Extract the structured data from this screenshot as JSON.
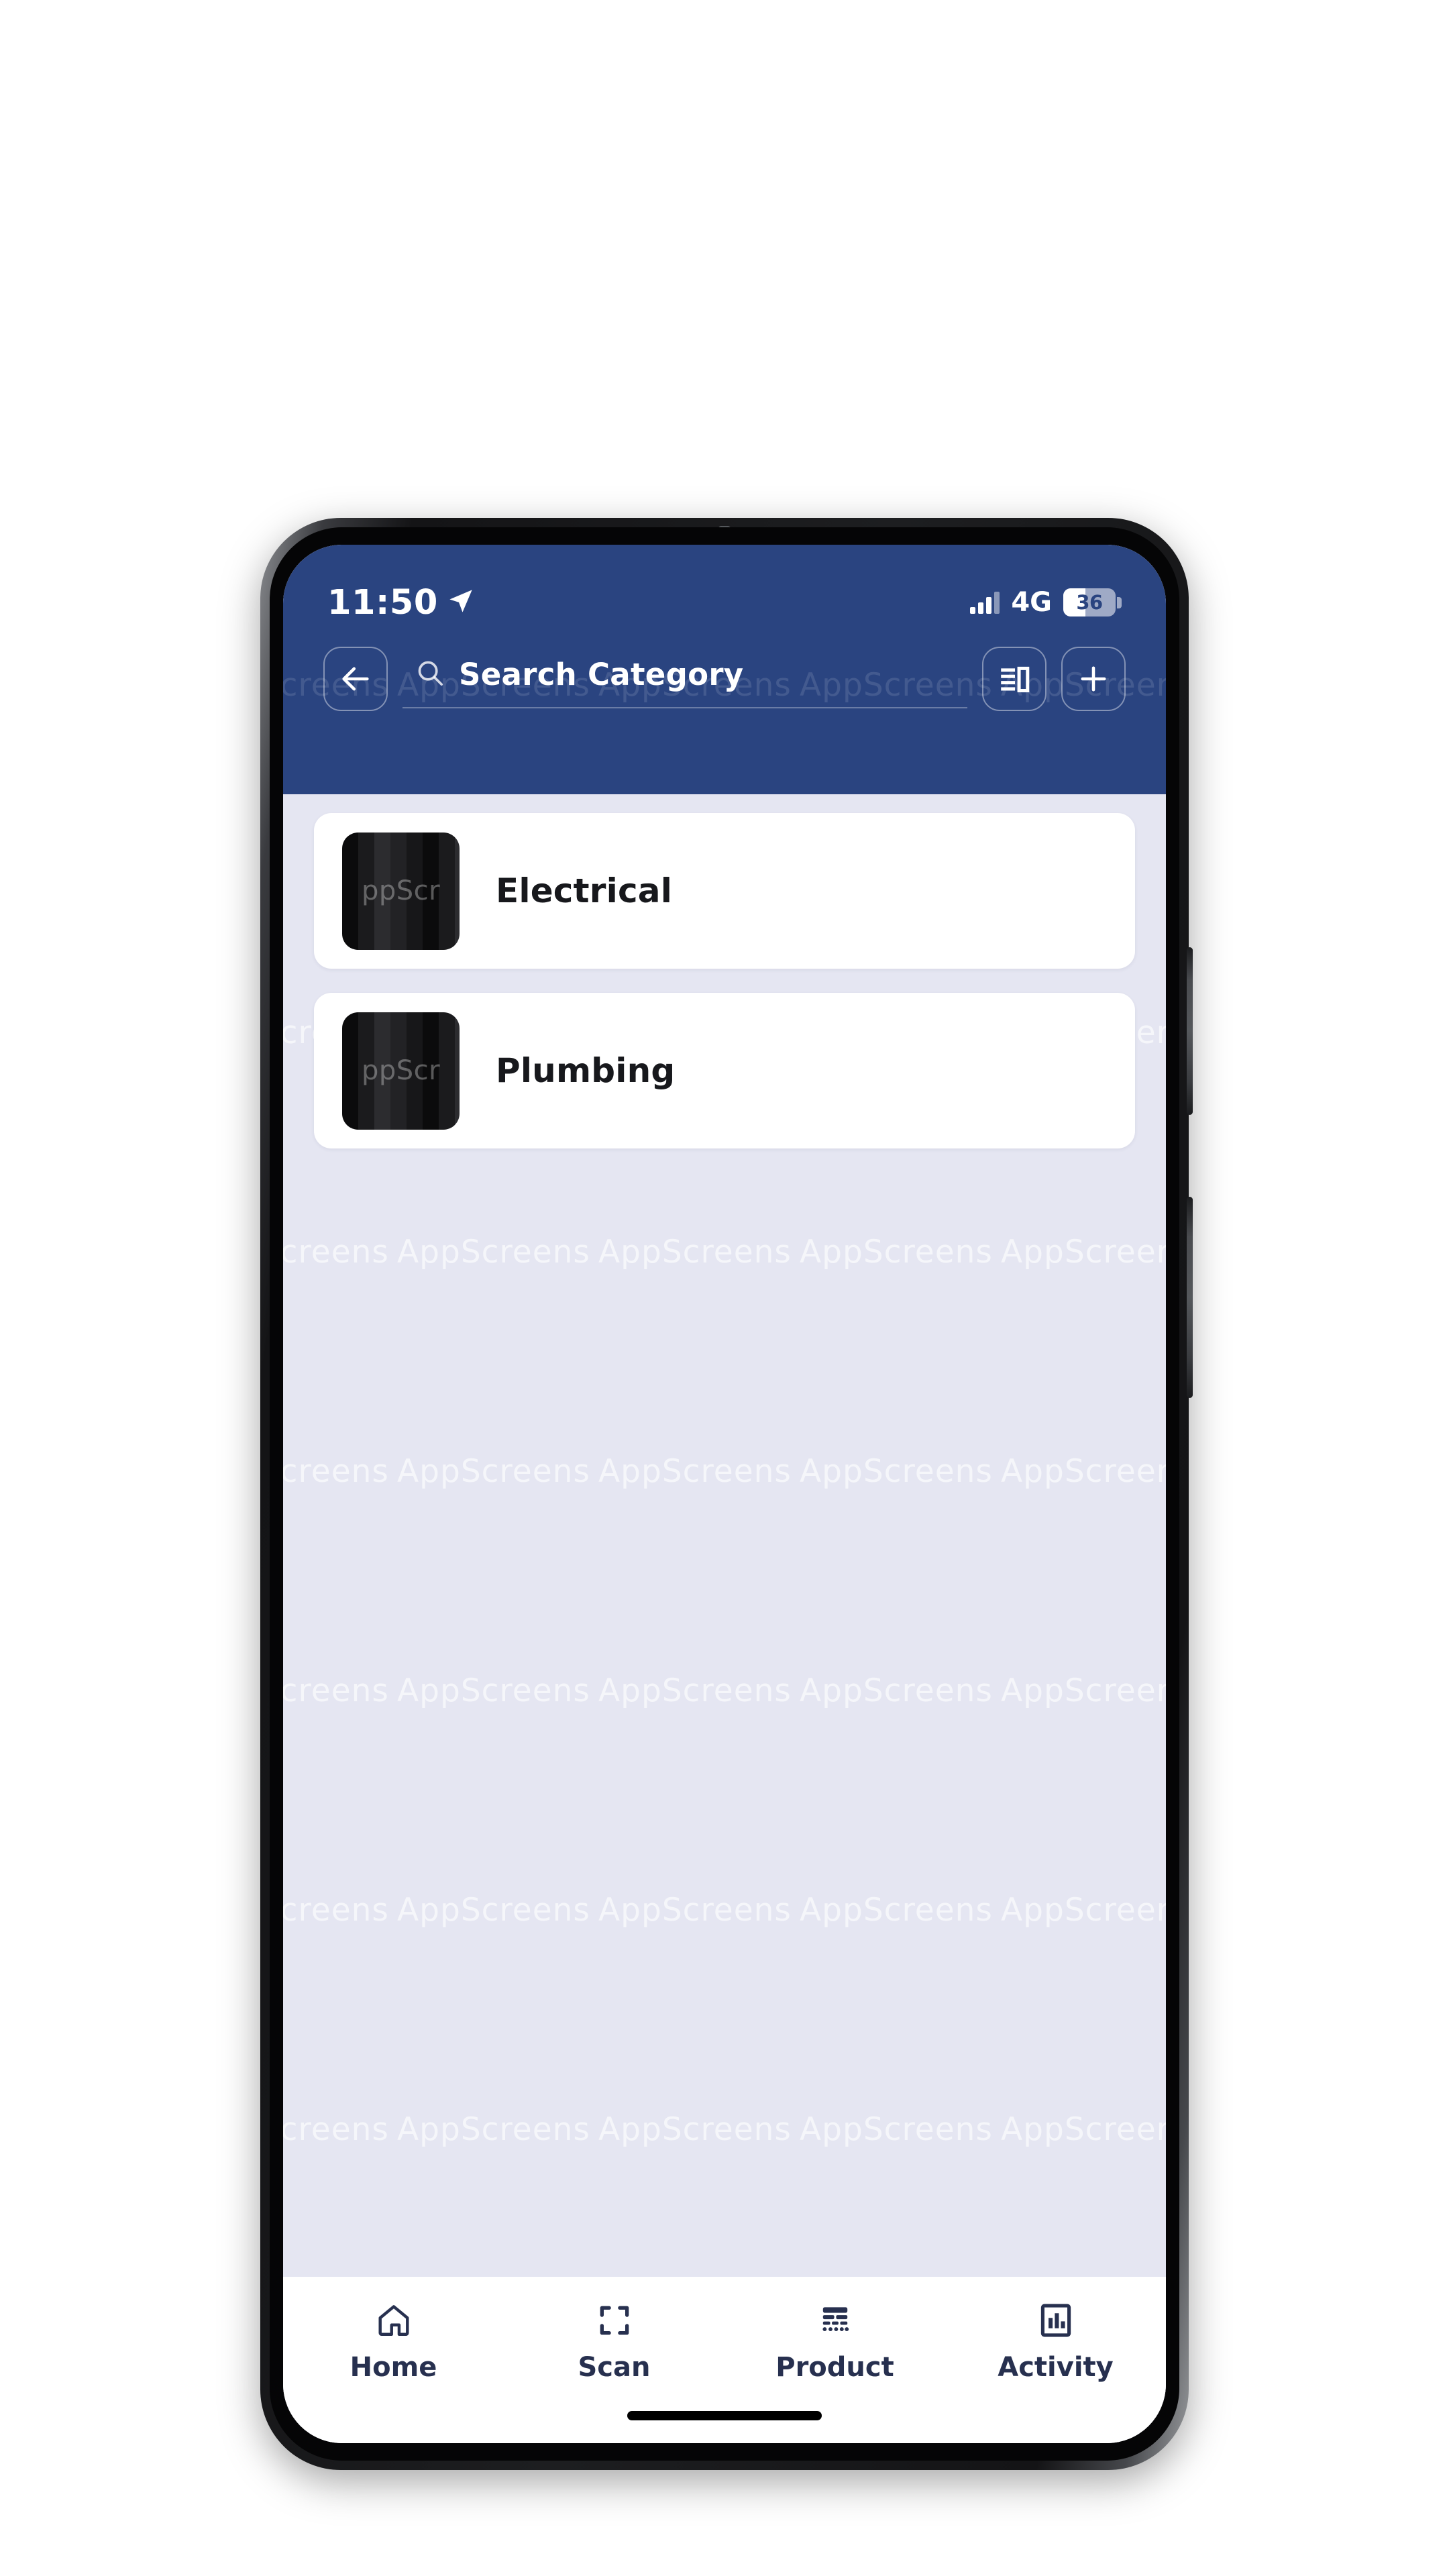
{
  "colors": {
    "header_blue": "#2a4480",
    "screen_background": "#e5e6f2",
    "card_white": "#ffffff",
    "nav_ink": "#27304f",
    "label_ink": "#17181c"
  },
  "status_bar": {
    "time": "11:50",
    "location_icon": "location-arrow-icon",
    "signal_icon": "signal-bars-icon",
    "network_type": "4G",
    "battery_level": "36",
    "battery_fill_percent": 42
  },
  "header": {
    "back_icon": "arrow-left-icon",
    "search": {
      "icon": "search-icon",
      "value": "",
      "placeholder": "Search Category"
    },
    "view_toggle_icon": "list-view-toggle-icon",
    "add_icon": "plus-icon"
  },
  "categories": [
    {
      "label": "Electrical",
      "thumb_watermark": "ppScr"
    },
    {
      "label": "Plumbing",
      "thumb_watermark": "ppScr"
    }
  ],
  "bottom_nav": {
    "items": [
      {
        "label": "Home",
        "icon": "home-icon"
      },
      {
        "label": "Scan",
        "icon": "scan-frame-icon"
      },
      {
        "label": "Product",
        "icon": "product-stack-icon"
      },
      {
        "label": "Activity",
        "icon": "activity-chart-icon"
      }
    ]
  },
  "watermark": {
    "text": "AppScreens",
    "repeat_text": "AppScreens   AppScreens   AppScreens   AppScreens"
  }
}
